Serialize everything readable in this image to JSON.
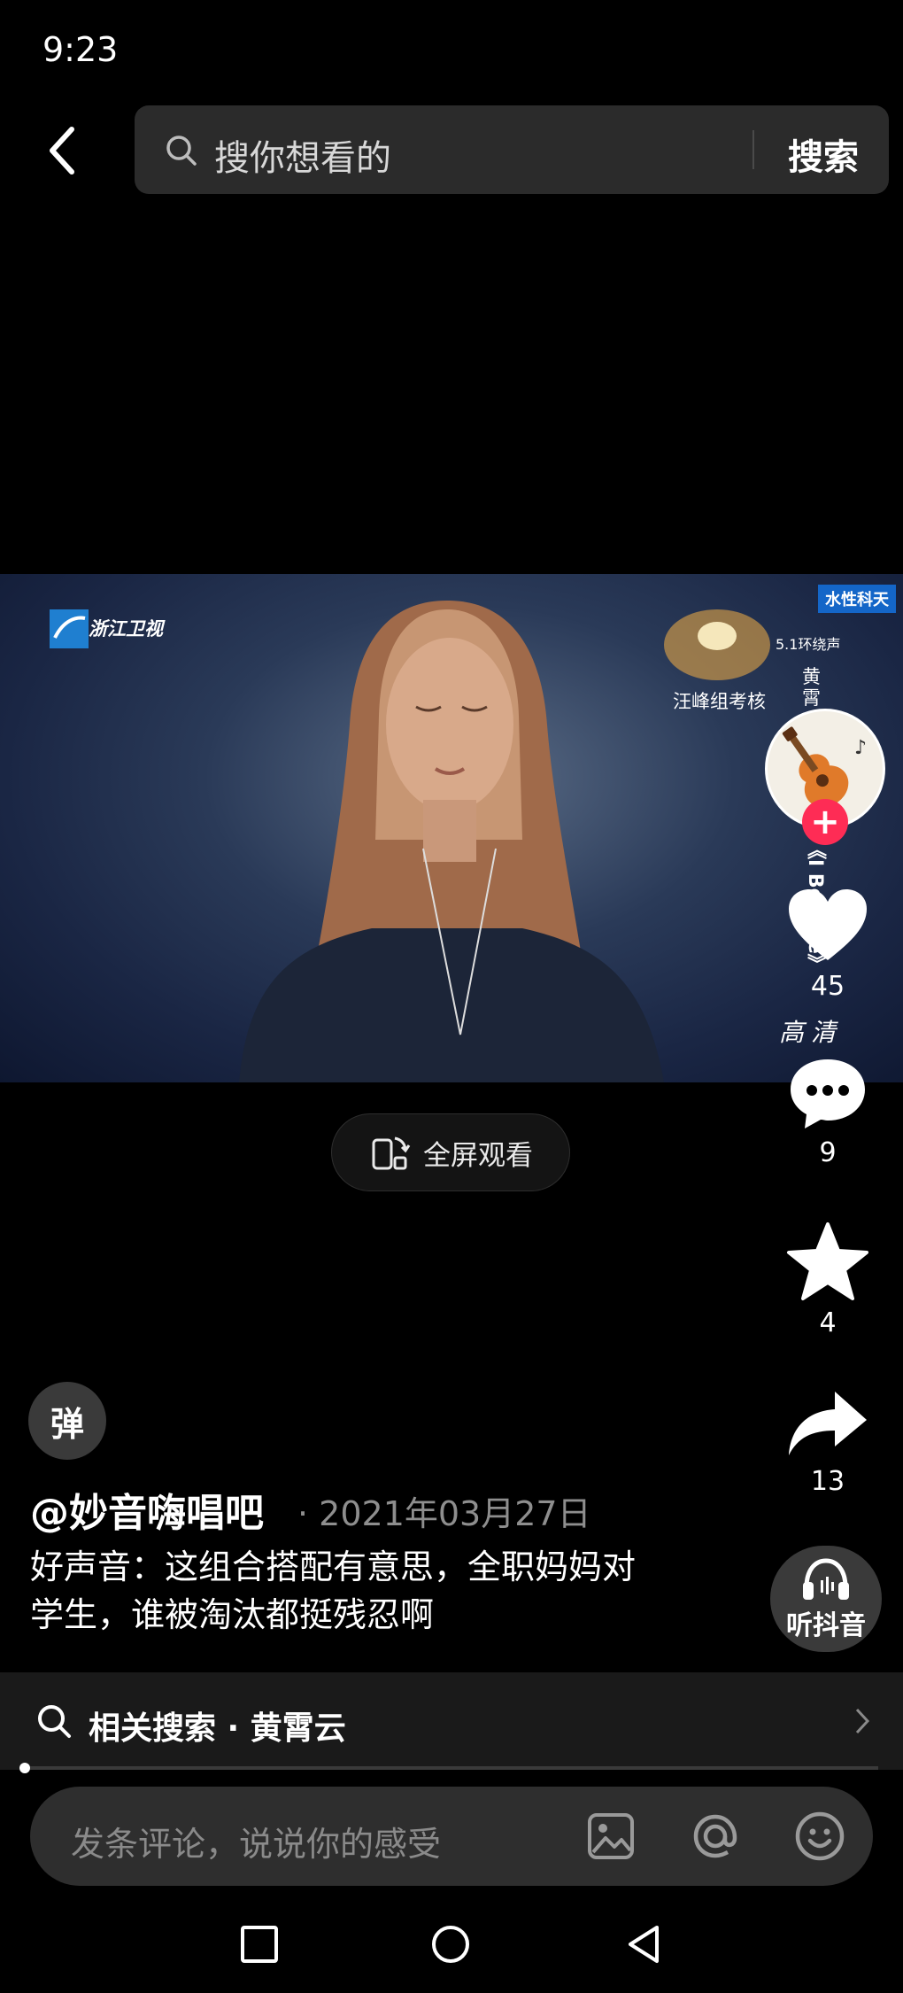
{
  "status_bar": {
    "time": "9:23"
  },
  "search": {
    "placeholder": "搜你想看的",
    "button_label": "搜索"
  },
  "video": {
    "channel_logo": "浙江卫视",
    "badge": "水性科天",
    "surround": "5.1环绕声",
    "caption": "汪峰组考核",
    "singer_vertical": "黄霄",
    "song_vertical": "《I Believe》",
    "quality": "高清"
  },
  "fullscreen": {
    "label": "全屏观看"
  },
  "rail": {
    "likes": "45",
    "comments": "9",
    "favorites": "4",
    "shares": "13",
    "listen_label": "听抖音"
  },
  "danmaku": {
    "label": "弹"
  },
  "post": {
    "author": "@妙音嗨唱吧",
    "date": "· 2021年03月27日",
    "description": "好声音：这组合搭配有意思，全职妈妈对学生，谁被淘汰都挺残忍啊"
  },
  "related_search": {
    "label": "相关搜索 · 黄霄云"
  },
  "comment_bar": {
    "placeholder": "发条评论，说说你的感受"
  },
  "colors": {
    "accent": "#fe2c55",
    "background": "#000000",
    "panel": "#2e2e2e"
  }
}
